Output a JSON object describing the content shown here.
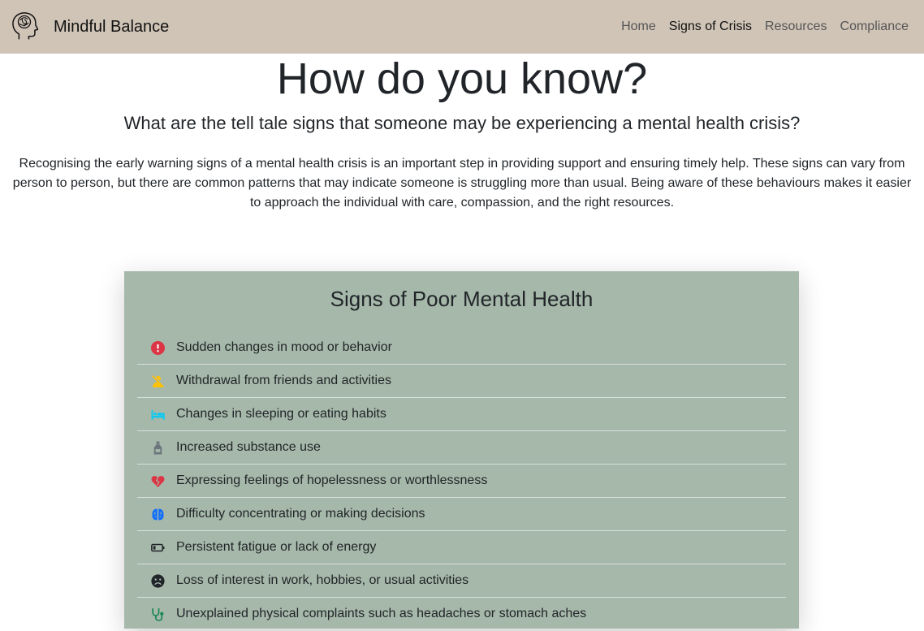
{
  "navbar": {
    "brand": {
      "name": "Mindful Balance",
      "logo_icon": "head-brain-icon"
    },
    "links": [
      {
        "label": "Home",
        "active": false
      },
      {
        "label": "Signs of Crisis",
        "active": true
      },
      {
        "label": "Resources",
        "active": false
      },
      {
        "label": "Compliance",
        "active": false
      }
    ]
  },
  "hero": {
    "title": "How do you know?",
    "subtitle": "What are the tell tale signs that someone may be experiencing a mental health crisis?",
    "intro": "Recognising the early warning signs of a mental health crisis is an important step in providing support and ensuring timely help. These signs can vary from person to person, but there are common patterns that may indicate someone is struggling more than usual. Being aware of these behaviours makes it easier to approach the individual with care, compassion, and the right resources."
  },
  "signs_card": {
    "title": "Signs of Poor Mental Health",
    "items": [
      {
        "text": "Sudden changes in mood or behavior",
        "icon": "exclamation-circle-icon",
        "icon_color": "#dc3545"
      },
      {
        "text": "Withdrawal from friends and activities",
        "icon": "person-slash-icon",
        "icon_color": "#ffc107"
      },
      {
        "text": "Changes in sleeping or eating habits",
        "icon": "bed-icon",
        "icon_color": "#0dcaf0"
      },
      {
        "text": "Increased substance use",
        "icon": "bottle-icon",
        "icon_color": "#6c757d"
      },
      {
        "text": "Expressing feelings of hopelessness or worthlessness",
        "icon": "heart-crack-icon",
        "icon_color": "#dc3545"
      },
      {
        "text": "Difficulty concentrating or making decisions",
        "icon": "brain-icon",
        "icon_color": "#0d6efd"
      },
      {
        "text": "Persistent fatigue or lack of energy",
        "icon": "battery-low-icon",
        "icon_color": "#212529"
      },
      {
        "text": "Loss of interest in work, hobbies, or usual activities",
        "icon": "frown-icon",
        "icon_color": "#212529"
      },
      {
        "text": "Unexplained physical complaints such as headaches or stomach aches",
        "icon": "stethoscope-icon",
        "icon_color": "#198754"
      }
    ]
  },
  "colors": {
    "navbar_bg": "#d0c4b7",
    "card_bg": "#a6b8aa",
    "text": "#212529"
  }
}
